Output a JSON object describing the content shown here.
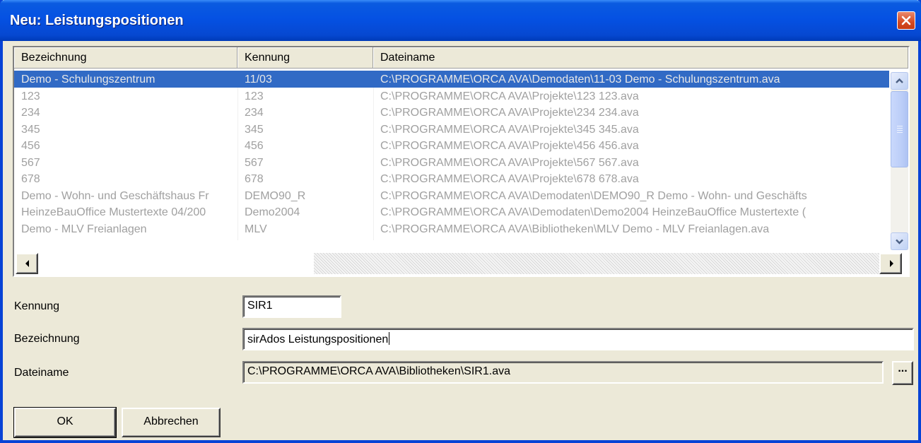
{
  "window": {
    "title": "Neu: Leistungspositionen"
  },
  "list": {
    "columns": [
      "Bezeichnung",
      "Kennung",
      "Dateiname"
    ],
    "rows": [
      [
        "Demo - Schulungszentrum",
        "11/03",
        "C:\\PROGRAMME\\ORCA AVA\\Demodaten\\11-03 Demo - Schulungszentrum.ava"
      ],
      [
        "123",
        "123",
        "C:\\PROGRAMME\\ORCA AVA\\Projekte\\123 123.ava"
      ],
      [
        "234",
        "234",
        "C:\\PROGRAMME\\ORCA AVA\\Projekte\\234 234.ava"
      ],
      [
        "345",
        "345",
        "C:\\PROGRAMME\\ORCA AVA\\Projekte\\345 345.ava"
      ],
      [
        "456",
        "456",
        "C:\\PROGRAMME\\ORCA AVA\\Projekte\\456 456.ava"
      ],
      [
        "567",
        "567",
        "C:\\PROGRAMME\\ORCA AVA\\Projekte\\567 567.ava"
      ],
      [
        "678",
        "678",
        "C:\\PROGRAMME\\ORCA AVA\\Projekte\\678 678.ava"
      ],
      [
        "Demo - Wohn- und Geschäftshaus Fr",
        "DEMO90_R",
        "C:\\PROGRAMME\\ORCA AVA\\Demodaten\\DEMO90_R Demo - Wohn- und Geschäfts"
      ],
      [
        "HeinzeBauOffice Mustertexte 04/200",
        "Demo2004",
        "C:\\PROGRAMME\\ORCA AVA\\Demodaten\\Demo2004 HeinzeBauOffice Mustertexte ("
      ],
      [
        "Demo - MLV Freianlagen",
        "MLV",
        "C:\\PROGRAMME\\ORCA AVA\\Bibliotheken\\MLV Demo - MLV Freianlagen.ava"
      ]
    ],
    "selected_row": 0
  },
  "form": {
    "kennung_label": "Kennung",
    "kennung_value": "SIR1",
    "bezeichnung_label": "Bezeichnung",
    "bezeichnung_value": "sirAdos Leistungspositionen",
    "dateiname_label": "Dateiname",
    "dateiname_value": "C:\\PROGRAMME\\ORCA AVA\\Bibliotheken\\SIR1.ava",
    "browse_label": "..."
  },
  "buttons": {
    "ok": "OK",
    "cancel": "Abbrechen"
  },
  "colors": {
    "titlebar": "#0551e3",
    "selection": "#316ac5",
    "dialog_bg": "#ece9d8",
    "close": "#d54a22"
  }
}
